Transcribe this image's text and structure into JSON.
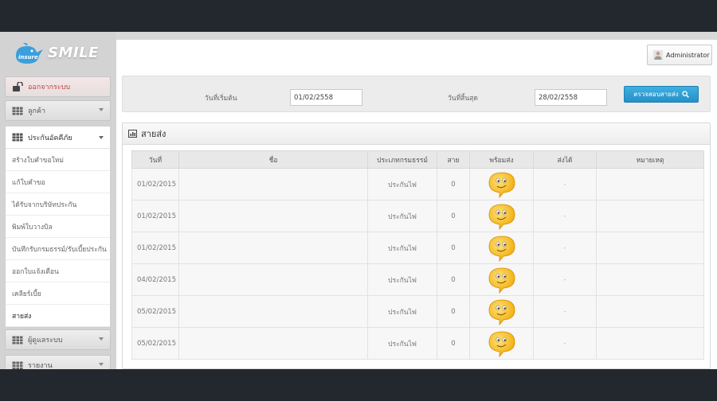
{
  "logo": {
    "badge": "insure",
    "brand": "SMILE"
  },
  "sidebar": {
    "logout_label": "ออกจากระบบ",
    "customers_label": "ลูกค้า",
    "insurance_label": "ประกันอัคคีภัย",
    "sub_items": [
      {
        "label": "สร้างใบคำขอใหม่"
      },
      {
        "label": "แก้ใบคำขอ"
      },
      {
        "label": "ได้รับจากบริษัทประกัน"
      },
      {
        "label": "พิมพ์ใบวางบิล"
      },
      {
        "label": "บันทึกรับกรมธรรม์/รับเบี้ยประกัน"
      },
      {
        "label": "ออกใบแจ้งเตือน"
      },
      {
        "label": "เคลียร์เบี้ย"
      },
      {
        "label": "สายส่ง"
      }
    ],
    "admin_label": "ผู้ดูแลระบบ",
    "report_label": "รายงาน"
  },
  "header": {
    "user_label": "Administrator"
  },
  "filter": {
    "start_label": "วันที่เริ่มต้น",
    "start_value": "01/02/2558",
    "end_label": "วันที่สิ้นสุด",
    "end_value": "28/02/2558",
    "check_label": "ตรวจสอบสายส่ง"
  },
  "panel": {
    "title": "สายส่ง"
  },
  "table": {
    "columns": [
      "วันที่",
      "ชื่อ",
      "ประเภทกรมธรรม์",
      "สาย",
      "พร้อมส่ง",
      "ส่งได้",
      "หมายเหตุ"
    ],
    "rows": [
      {
        "date": "01/02/2015",
        "name": "",
        "type": "ประกันไฟ",
        "line": "0",
        "sent": "-",
        "note": ""
      },
      {
        "date": "01/02/2015",
        "name": "",
        "type": "ประกันไฟ",
        "line": "0",
        "sent": "-",
        "note": ""
      },
      {
        "date": "01/02/2015",
        "name": "",
        "type": "ประกันไฟ",
        "line": "0",
        "sent": "-",
        "note": ""
      },
      {
        "date": "04/02/2015",
        "name": "",
        "type": "ประกันไฟ",
        "line": "0",
        "sent": "-",
        "note": ""
      },
      {
        "date": "05/02/2015",
        "name": "",
        "type": "ประกันไฟ",
        "line": "0",
        "sent": "-",
        "note": ""
      },
      {
        "date": "05/02/2015",
        "name": "",
        "type": "ประกันไฟ",
        "line": "0",
        "sent": "-",
        "note": ""
      }
    ]
  },
  "colors": {
    "accent": "#2a9bd4",
    "smiley": "#f5b400",
    "sidebar_bg": "#d3d3d3"
  }
}
